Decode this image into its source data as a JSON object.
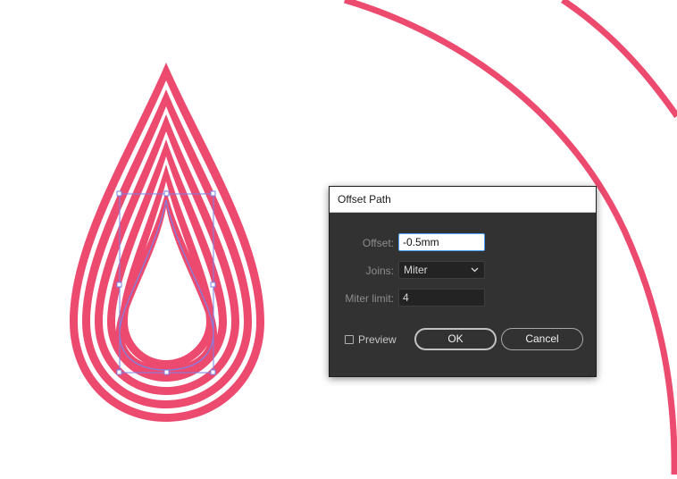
{
  "colors": {
    "accent": "#ec4a6f",
    "selection": "#7b82e8",
    "dialog_bg": "#323232",
    "focus": "#46a0f5"
  },
  "dialog": {
    "title": "Offset Path",
    "offset_label": "Offset:",
    "offset_value": "-0.5mm",
    "joins_label": "Joins:",
    "joins_value": "Miter",
    "joins_icon": "chevron-down-icon",
    "miter_label": "Miter limit:",
    "miter_value": "4",
    "preview_label": "Preview",
    "preview_checked": false,
    "ok_label": "OK",
    "cancel_label": "Cancel"
  }
}
